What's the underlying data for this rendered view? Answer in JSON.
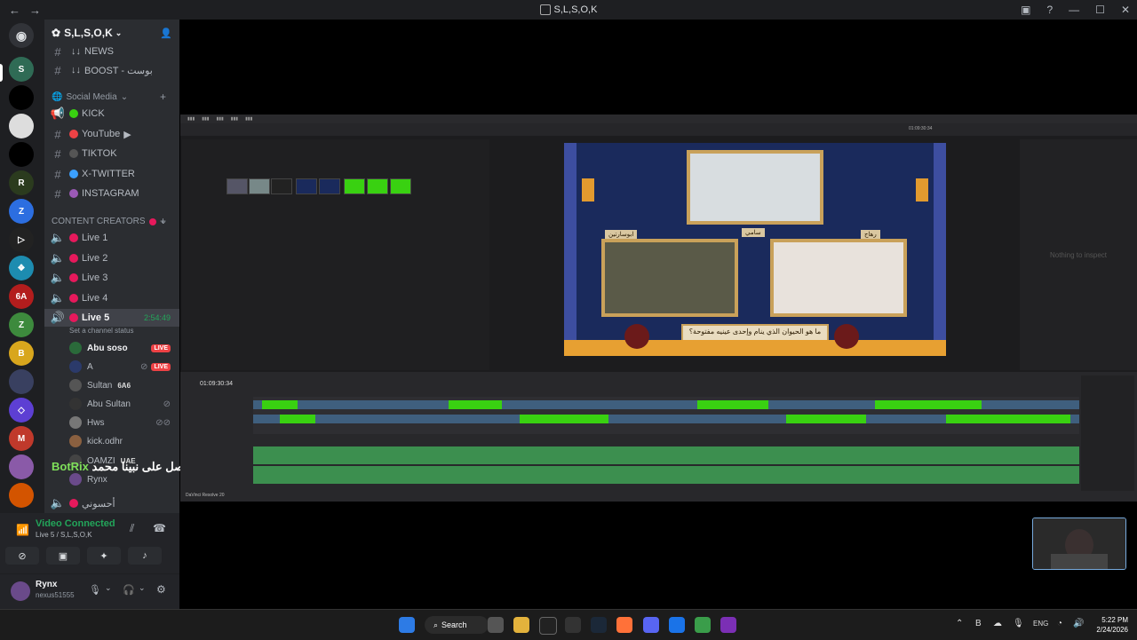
{
  "window": {
    "title": "S,L,S,O,K",
    "back_label": "←",
    "forward_label": "→"
  },
  "server": {
    "name": "S,L,S,O,K"
  },
  "channels_top": [
    {
      "label": "NEWS",
      "prefix": "↓↓"
    },
    {
      "label": "BOOST - بوست",
      "prefix": "↓↓"
    }
  ],
  "categories": {
    "social": "Social Media",
    "creators": "CONTENT CREATORS"
  },
  "social_channels": [
    {
      "label": "KICK",
      "color": "#39d111"
    },
    {
      "label": "YouTube",
      "color": "#ed4245"
    },
    {
      "label": "TIKTOK",
      "color": "#888888"
    },
    {
      "label": "X-TWITTER",
      "color": "#3ba0ff"
    },
    {
      "label": "INSTAGRAM",
      "color": "#9b59b6"
    }
  ],
  "creator_channels": [
    {
      "label": "Live 1"
    },
    {
      "label": "Live 2"
    },
    {
      "label": "Live 3"
    },
    {
      "label": "Live 4"
    },
    {
      "label": "Live 5",
      "timer": "2:54:49",
      "status": "Set a channel status"
    }
  ],
  "voice_users": [
    {
      "name": "Abu soso",
      "badge": "LIVE"
    },
    {
      "name": "A",
      "badge": "LIVE"
    },
    {
      "name": "Sultan",
      "tag": "6A6"
    },
    {
      "name": "Abu Sultan"
    },
    {
      "name": "Hws"
    },
    {
      "name": "kick.odhr"
    },
    {
      "name": "OAMZI",
      "tag": "UAE"
    },
    {
      "name": "Rynx"
    }
  ],
  "last_channel": "أحسوني",
  "overlay": {
    "bot": "BotRix",
    "text": "صل على نبينا محمد"
  },
  "voice": {
    "status": "Video Connected",
    "channel": "Live 5 / S,L,S,O,K"
  },
  "user": {
    "name": "Rynx",
    "tag": "nexus51555"
  },
  "resolve": {
    "timecode_viewer": "01:09:30:34",
    "timecode_timeline": "01:09:30:34",
    "inspector_text": "Nothing to inspect",
    "project": "DaVinci Resolve 20",
    "question": "ما هو الحيوان الذي ينام وإحدى عينيه مفتوحة؟",
    "labels": [
      "سامي",
      "ابوسارتين",
      "رهاج"
    ]
  },
  "taskbar": {
    "search": "Search",
    "lang": "ENG",
    "time": "5:22 PM",
    "date": "2/24/2026"
  }
}
